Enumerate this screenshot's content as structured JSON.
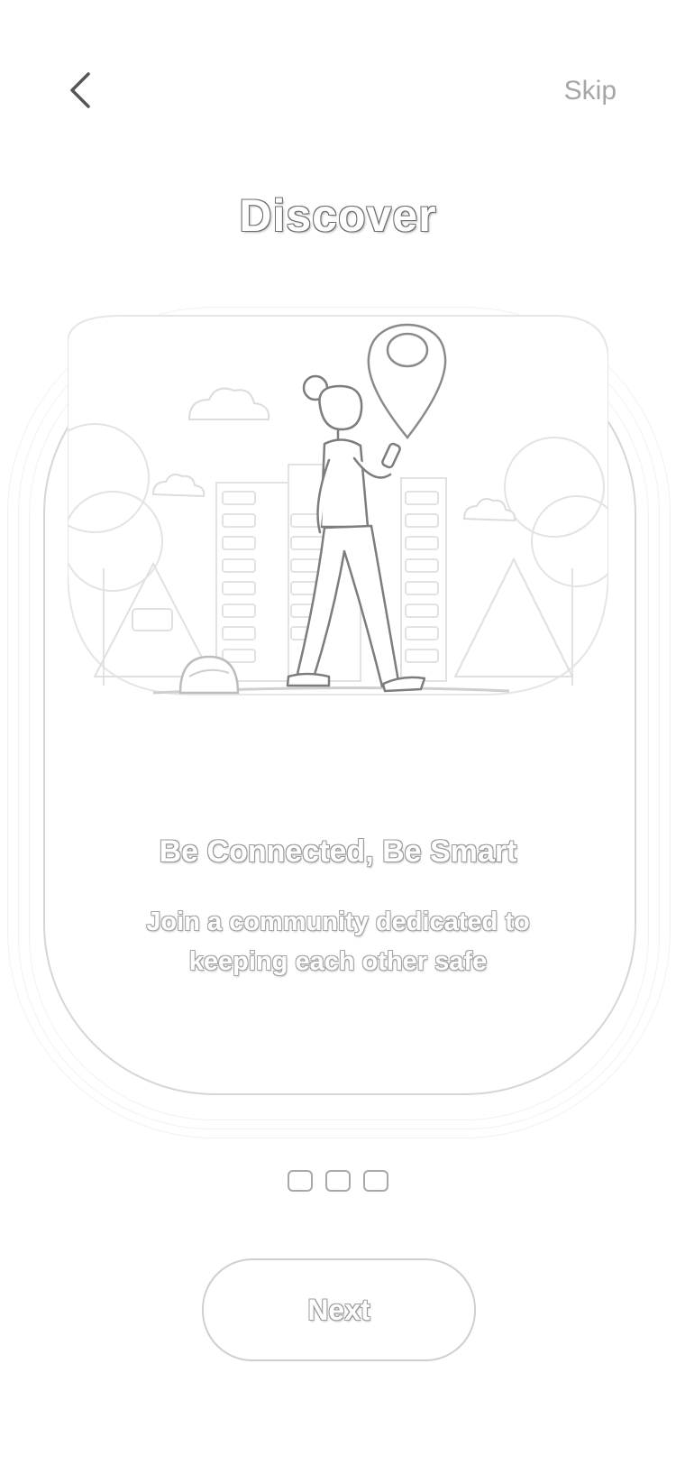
{
  "header": {
    "back_icon": "chevron-left-icon",
    "skip_label": "Skip"
  },
  "title": "Discover",
  "illustration": {
    "icons": [
      "location-pin-icon",
      "woman-walking-with-phone",
      "city-buildings",
      "trees",
      "clouds"
    ]
  },
  "content": {
    "headline": "Be Connected, Be Smart",
    "body": "Join a community dedicated to keeping each other safe"
  },
  "pagination": {
    "pages": 3
  },
  "footer": {
    "next_label": "Next"
  },
  "colors": {
    "outline": "#d6d6d6",
    "text_outline": "#9a9a9a",
    "background": "#ffffff"
  }
}
